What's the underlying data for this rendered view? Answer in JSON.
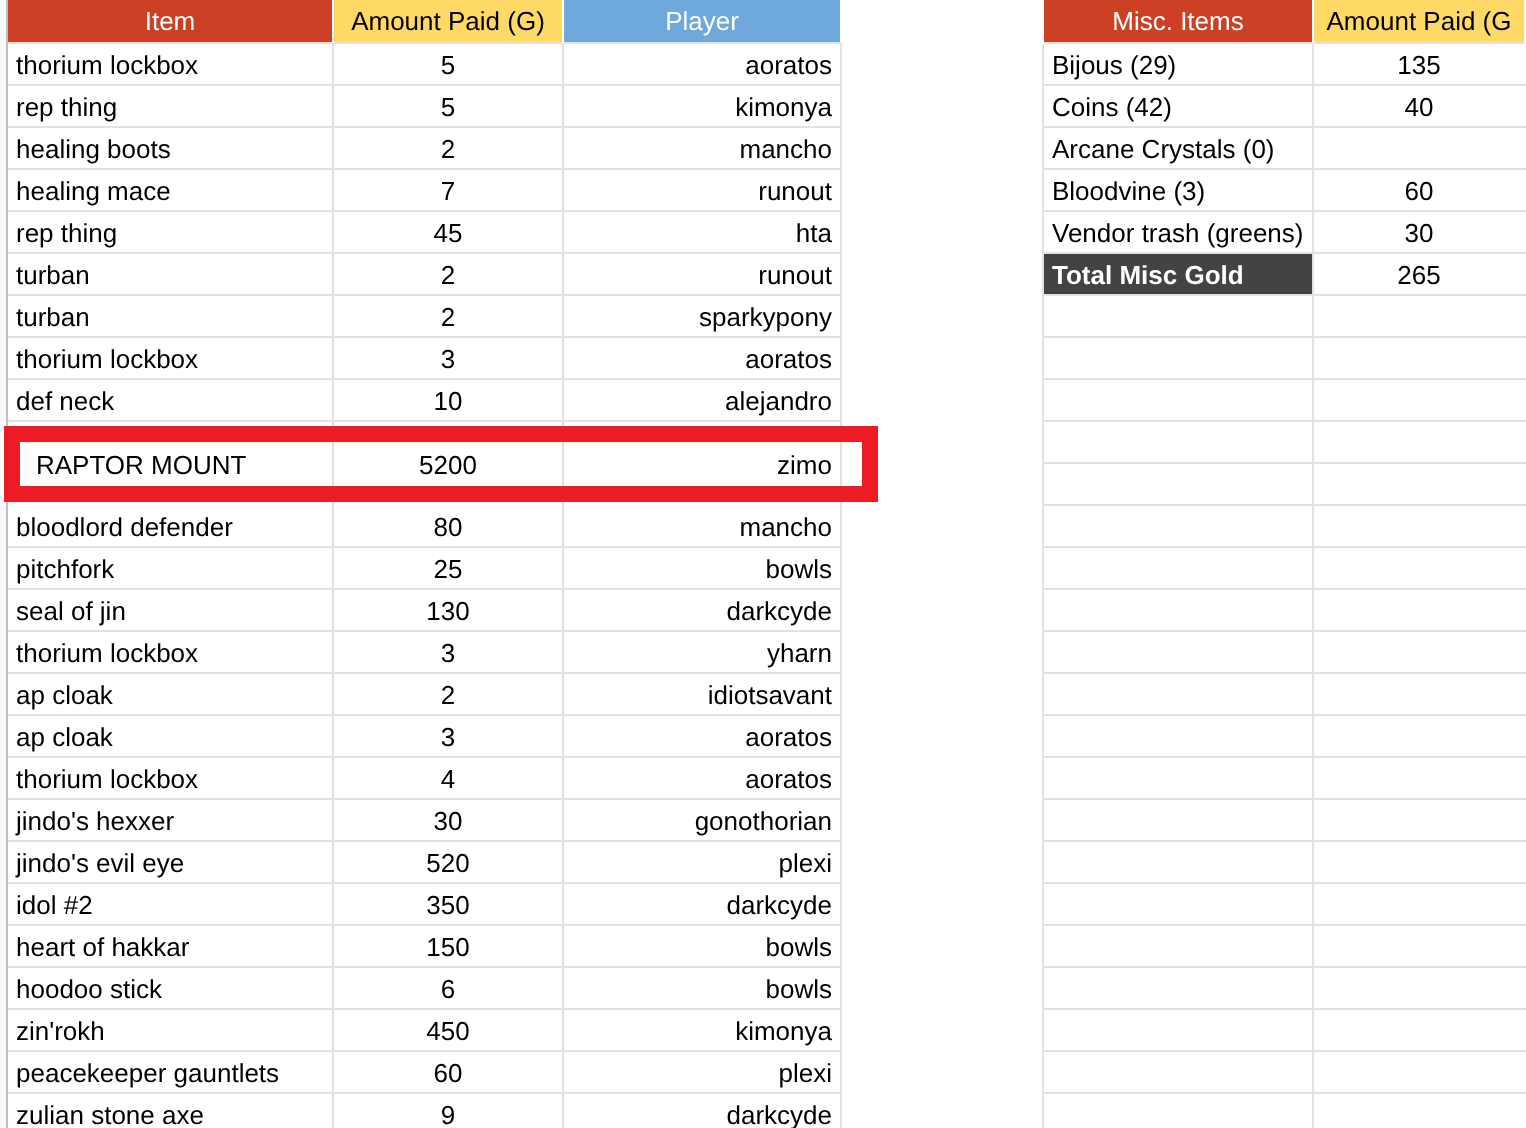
{
  "loot_table": {
    "columns": [
      {
        "label": "Item",
        "color": "#cc4125"
      },
      {
        "label": "Amount Paid (G)",
        "color": "#ffd966"
      },
      {
        "label": "Player",
        "color": "#6fa8dc"
      }
    ],
    "rows": [
      {
        "item": "thorium lockbox",
        "amount": "5",
        "player": "aoratos",
        "highlighted": false
      },
      {
        "item": "rep thing",
        "amount": "5",
        "player": "kimonya",
        "highlighted": false
      },
      {
        "item": "healing boots",
        "amount": "2",
        "player": "mancho",
        "highlighted": false
      },
      {
        "item": "healing mace",
        "amount": "7",
        "player": "runout",
        "highlighted": false
      },
      {
        "item": "rep thing",
        "amount": "45",
        "player": "hta",
        "highlighted": false
      },
      {
        "item": "turban",
        "amount": "2",
        "player": "runout",
        "highlighted": false
      },
      {
        "item": "turban",
        "amount": "2",
        "player": "sparkypony",
        "highlighted": false
      },
      {
        "item": "thorium lockbox",
        "amount": "3",
        "player": "aoratos",
        "highlighted": false
      },
      {
        "item": "def neck",
        "amount": "10",
        "player": "alejandro",
        "highlighted": false
      },
      {
        "item": "RAPTOR MOUNT",
        "amount": "5200",
        "player": "zimo",
        "highlighted": true
      },
      {
        "item": "bloodlord defender",
        "amount": "80",
        "player": "mancho",
        "highlighted": false
      },
      {
        "item": "pitchfork",
        "amount": "25",
        "player": "bowls",
        "highlighted": false
      },
      {
        "item": "seal of jin",
        "amount": "130",
        "player": "darkcyde",
        "highlighted": false
      },
      {
        "item": "thorium lockbox",
        "amount": "3",
        "player": "yharn",
        "highlighted": false
      },
      {
        "item": "ap cloak",
        "amount": "2",
        "player": "idiotsavant",
        "highlighted": false
      },
      {
        "item": "ap cloak",
        "amount": "3",
        "player": "aoratos",
        "highlighted": false
      },
      {
        "item": "thorium lockbox",
        "amount": "4",
        "player": "aoratos",
        "highlighted": false
      },
      {
        "item": "jindo's hexxer",
        "amount": "30",
        "player": "gonothorian",
        "highlighted": false
      },
      {
        "item": "jindo's evil eye",
        "amount": "520",
        "player": "plexi",
        "highlighted": false
      },
      {
        "item": "idol #2",
        "amount": "350",
        "player": "darkcyde",
        "highlighted": false
      },
      {
        "item": "heart of hakkar",
        "amount": "150",
        "player": "bowls",
        "highlighted": false
      },
      {
        "item": "hoodoo stick",
        "amount": "6",
        "player": "bowls",
        "highlighted": false
      },
      {
        "item": "zin'rokh",
        "amount": "450",
        "player": "kimonya",
        "highlighted": false
      },
      {
        "item": "peacekeeper gauntlets",
        "amount": "60",
        "player": "plexi",
        "highlighted": false
      },
      {
        "item": "zulian stone axe",
        "amount": "9",
        "player": "darkcyde",
        "highlighted": false
      }
    ]
  },
  "misc_table": {
    "columns": [
      {
        "label": "Misc. Items",
        "color": "#cc4125"
      },
      {
        "label": "Amount Paid (G",
        "color": "#ffd966"
      }
    ],
    "rows": [
      {
        "kind": "item",
        "name": "Bijous (29)",
        "amount": "135"
      },
      {
        "kind": "item",
        "name": "Coins (42)",
        "amount": "40"
      },
      {
        "kind": "item",
        "name": "Arcane Crystals (0)"
      },
      {
        "kind": "item",
        "name": "Bloodvine (3)",
        "amount": "60"
      },
      {
        "kind": "item",
        "name": "Vendor trash (greens)",
        "amount": "30"
      },
      {
        "kind": "total",
        "name": "Total Misc Gold",
        "amount": "265"
      }
    ]
  }
}
